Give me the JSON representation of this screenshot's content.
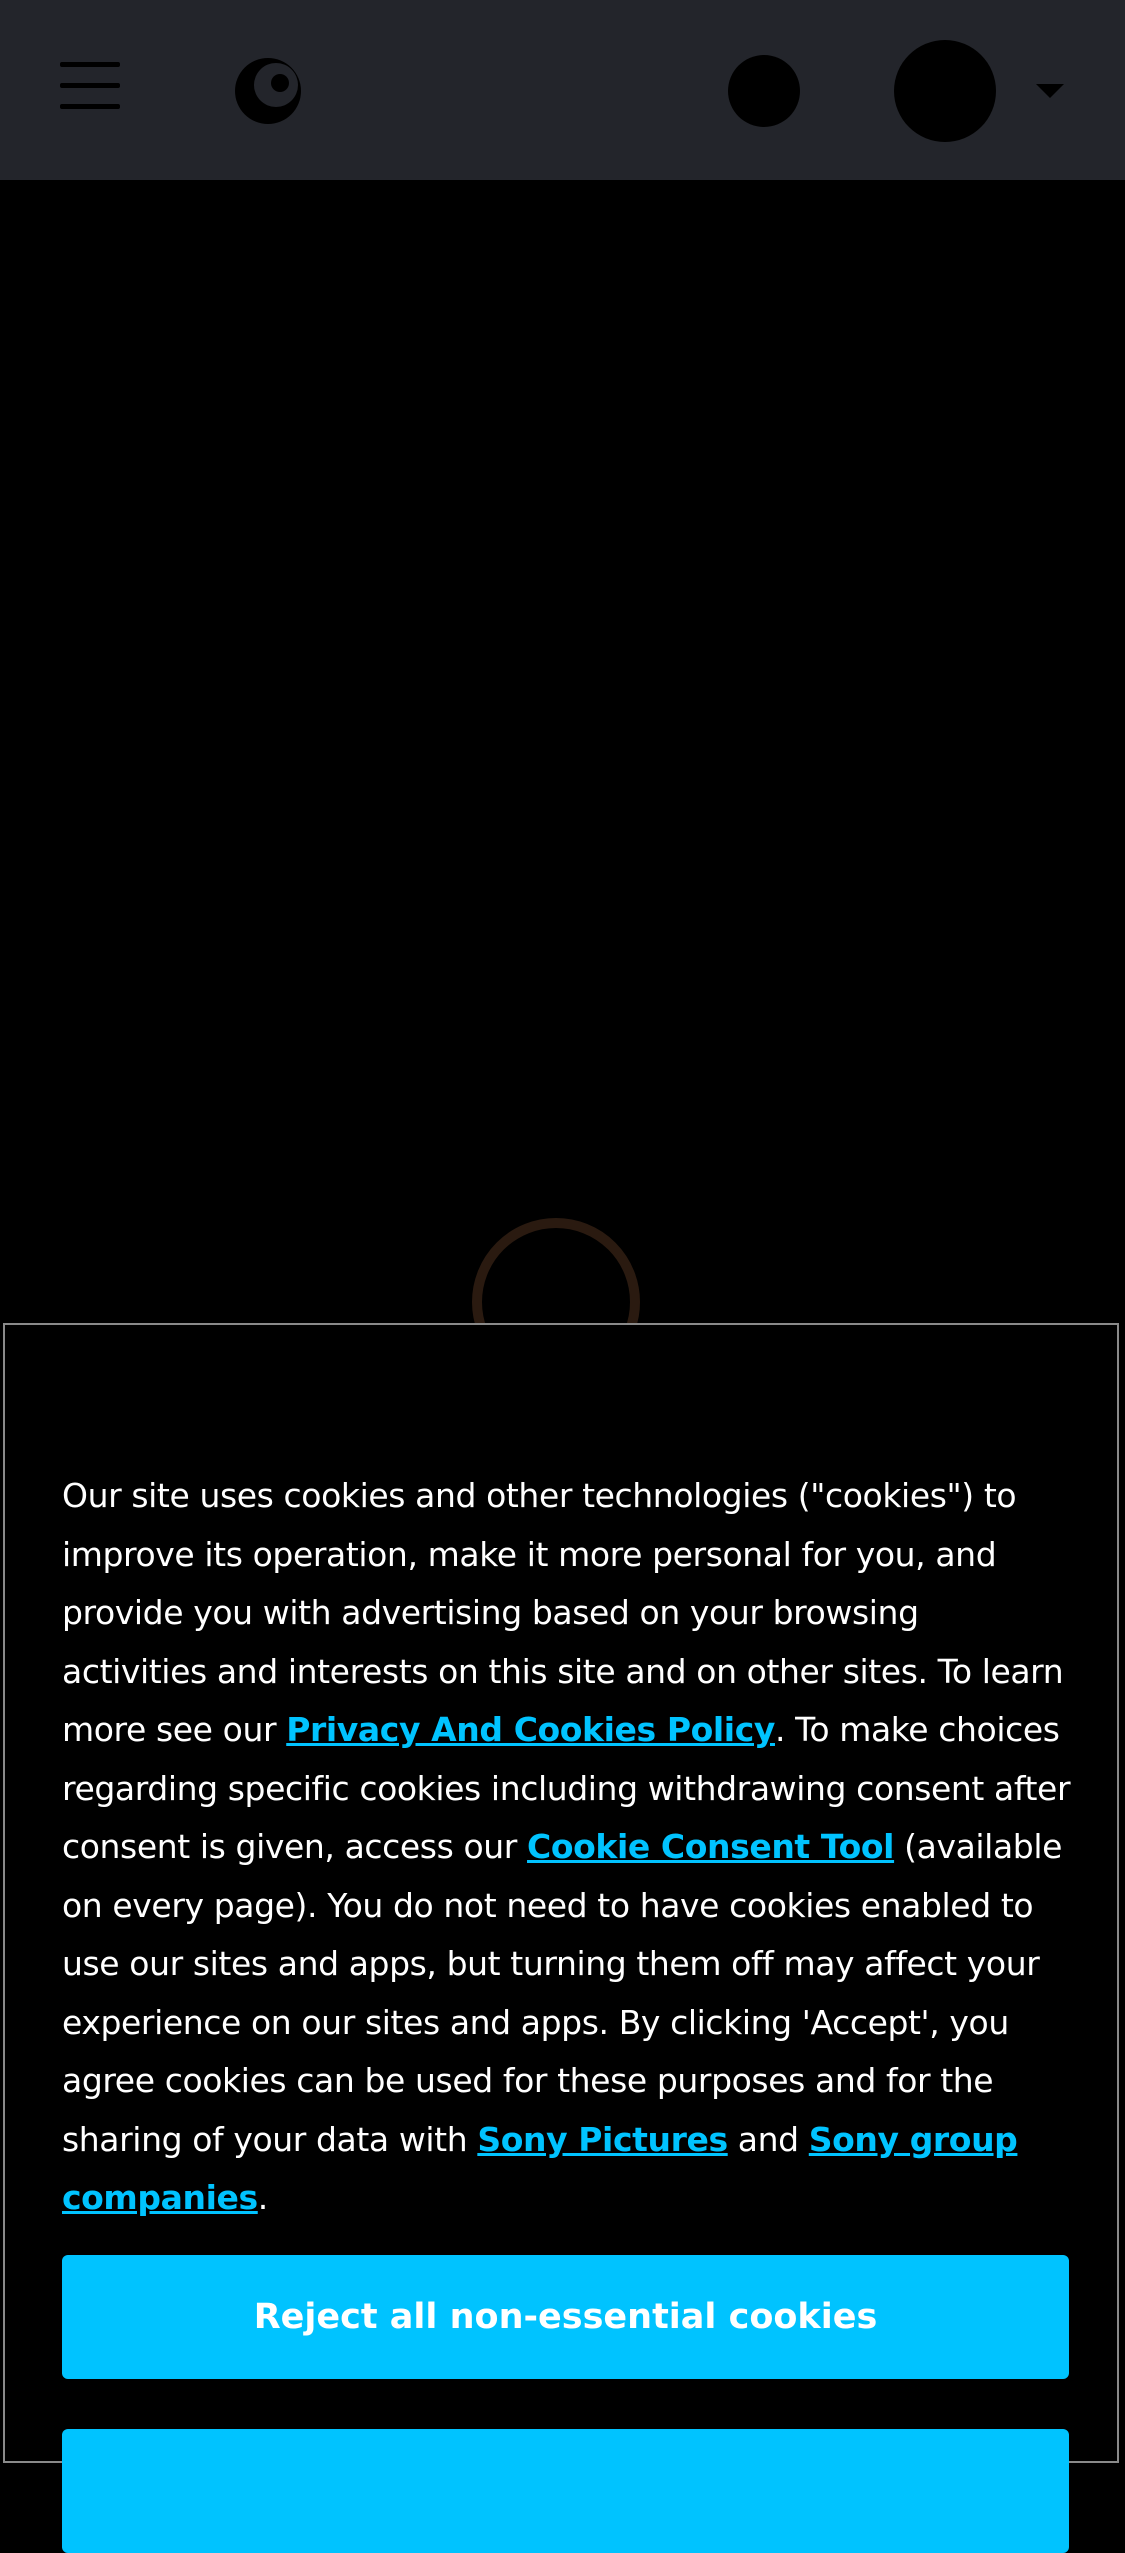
{
  "header": {
    "menu_icon": "hamburger-menu-icon",
    "logo_icon": "crunchyroll-logo-icon",
    "search_icon": "search-icon",
    "avatar_icon": "user-avatar-icon",
    "dropdown_icon": "caret-down-icon",
    "background_color": "#23252b"
  },
  "loading": {
    "spinner_icon": "loading-spinner-icon",
    "color": "#2a1a10"
  },
  "cookie_banner": {
    "text_1": "Our site uses cookies and other technologies (\"cookies\") to improve its operation, make it more personal for you, and provide you with advertising based on your browsing activities and interests on this site and on other sites. To learn more see our ",
    "link_privacy": "Privacy And Cookies Policy",
    "text_2": ". To make choices regarding specific cookies including withdrawing consent after consent is given, access our ",
    "link_consent_tool": "Cookie Consent Tool",
    "text_3": " (available on every page). You do not need to have cookies enabled to use our sites and apps, but turning them off may affect your experience on our sites and apps. By clicking 'Accept', you agree cookies can be used for these purposes and for the sharing of your data with ",
    "link_sony_pictures": "Sony Pictures",
    "text_4": " and ",
    "link_sony_group": "Sony group companies",
    "text_5": ".",
    "reject_label": "Reject all non-essential cookies",
    "accept_label": "",
    "link_color": "#00c3ff",
    "button_color": "#00c3ff"
  }
}
